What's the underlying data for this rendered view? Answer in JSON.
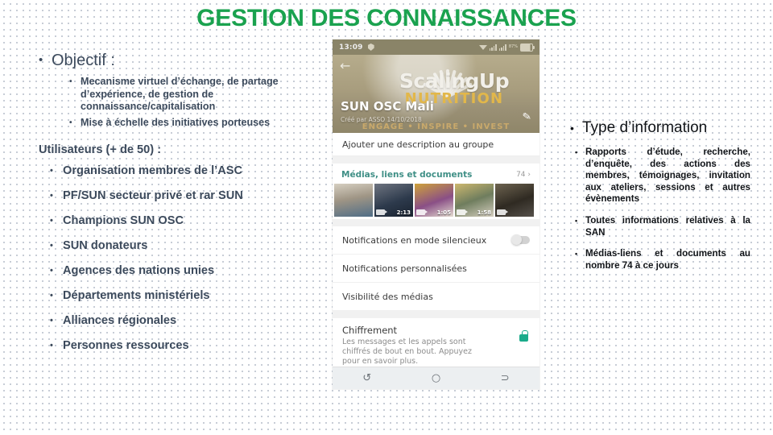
{
  "slide": {
    "title": "GESTION DES CONNAISSANCES",
    "theme_green": "#1aa24f",
    "left_text_color": "#3c4a5c"
  },
  "left": {
    "objective_heading": "Objectif :",
    "objective_points": [
      "Mecanisme virtuel d’échange, de partage d’expérience, de gestion de connaissance/capitalisation",
      "Mise à échelle des initiatives porteuses"
    ],
    "users_heading": "Utilisateurs (+ de 50) :",
    "users": [
      "Organisation membres de l’ASC",
      "PF/SUN secteur privé et rar SUN",
      "Champions SUN OSC",
      "SUN donateurs",
      "Agences des nations unies",
      "Départements ministériels",
      "Alliances régionales",
      "Personnes ressources"
    ]
  },
  "right": {
    "heading": "Type d’information",
    "items": [
      "Rapports d’étude, recherche, d’enquête, des actions des membres, témoignages, invitation aux ateliers, sessions et autres évènements",
      "Toutes informations relatives à la SAN",
      "Médias-liens et documents au nombre 74 à ce jours"
    ]
  },
  "phone": {
    "status": {
      "time": "13:09",
      "battery_percent": "87%"
    },
    "banner": {
      "brand": "ScalingUp",
      "nutrition": "NUTRITION",
      "tagline": "ENGAGE • INSPIRE • INVEST",
      "group_name": "SUN OSC Mali",
      "created_by": "Créé par ASSO 14/10/2018"
    },
    "description_row": "Ajouter une description au groupe",
    "media": {
      "label": "Médias, liens et documents",
      "count": "74 ›",
      "thumbnails": [
        {
          "duration": ""
        },
        {
          "duration": "2:13"
        },
        {
          "duration": "1:05"
        },
        {
          "duration": "1:58"
        },
        {
          "duration": ""
        }
      ]
    },
    "settings": [
      "Notifications en mode silencieux",
      "Notifications personnalisées",
      "Visibilité des médias"
    ],
    "encryption": {
      "title": "Chiffrement",
      "body": "Les messages et les appels sont chiffrés de bout en bout. Appuyez pour en savoir plus."
    },
    "nav": {
      "recents": "↺",
      "home": "○",
      "back": "⊃"
    }
  }
}
